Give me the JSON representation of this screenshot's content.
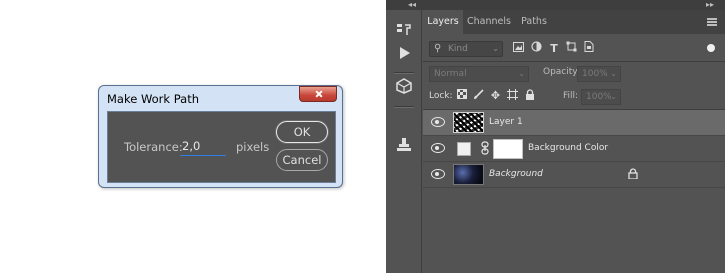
{
  "dialog": {
    "title": "Make Work Path",
    "tolerance_label": "Tolerance:",
    "tolerance_value": "2,0",
    "tolerance_unit": "pixels",
    "ok_label": "OK",
    "cancel_label": "Cancel"
  },
  "dock": {
    "collapse_left": "◂◂",
    "collapse_right": "▸▸"
  },
  "toolstrip": {
    "icons": [
      "history-icon",
      "play-actions-icon",
      "3d-icon",
      "clone-source-icon"
    ]
  },
  "layers_panel": {
    "tabs": [
      {
        "label": "Layers",
        "active": true
      },
      {
        "label": "Channels",
        "active": false
      },
      {
        "label": "Paths",
        "active": false
      }
    ],
    "filter": {
      "kind_placeholder": "Kind"
    },
    "blend_mode": "Normal",
    "opacity_label": "Opacity:",
    "opacity_value": "100%",
    "lock_label": "Lock:",
    "fill_label": "Fill:",
    "fill_value": "100%",
    "layers": [
      {
        "name": "Layer 1",
        "selected": true,
        "italic": false
      },
      {
        "name": "Background Color",
        "selected": false,
        "italic": false
      },
      {
        "name": "Background",
        "selected": false,
        "italic": true
      }
    ]
  },
  "colors": {
    "panel_bg": "#535353",
    "tab_bar_bg": "#424242",
    "selected_row": "#6a6a6a",
    "dialog_frame": "#d3e3f5",
    "input_underline": "#2f7ee8"
  }
}
